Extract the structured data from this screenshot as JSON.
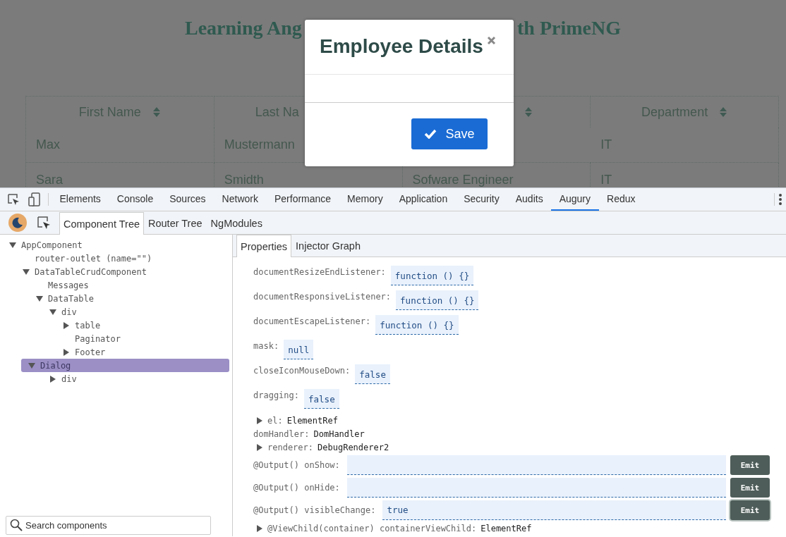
{
  "app": {
    "title_parts": [
      "Learning Ang",
      "th PrimeNG"
    ],
    "table": {
      "columns": [
        {
          "label": "First Name",
          "sortable": true
        },
        {
          "label": "Last Na"
        },
        {
          "sortable": true
        },
        {
          "label": "Department",
          "sortable": true
        }
      ],
      "rows": [
        [
          "Max",
          "Mustermann",
          null,
          "IT"
        ],
        [
          "Sara",
          "Smidth",
          "Sofware Engineer",
          "IT"
        ]
      ]
    }
  },
  "dialog": {
    "title": "Employee Details",
    "save_button": "Save"
  },
  "devtools": {
    "tabs": [
      {
        "label": "Elements",
        "selected": false
      },
      {
        "label": "Console",
        "selected": false
      },
      {
        "label": "Sources",
        "selected": false
      },
      {
        "label": "Network",
        "selected": false
      },
      {
        "label": "Performance",
        "selected": false
      },
      {
        "label": "Memory",
        "selected": false
      },
      {
        "label": "Application",
        "selected": false
      },
      {
        "label": "Security",
        "selected": false
      },
      {
        "label": "Audits",
        "selected": false
      },
      {
        "label": "Augury",
        "selected": true
      },
      {
        "label": "Redux",
        "selected": false
      }
    ],
    "augury_tabs": [
      {
        "label": "Component Tree",
        "selected": true
      },
      {
        "label": "Router Tree",
        "selected": false
      },
      {
        "label": "NgModules",
        "selected": false
      }
    ],
    "tree": [
      {
        "label": "AppComponent",
        "kind": "branch",
        "expanded": true,
        "selected": false,
        "children": [
          {
            "label": "router-outlet (name=\"\")",
            "kind": "leaf",
            "selected": false
          },
          {
            "label": "DataTableCrudComponent",
            "kind": "branch",
            "expanded": true,
            "selected": false,
            "children": [
              {
                "label": "Messages",
                "kind": "leaf",
                "selected": false
              },
              {
                "label": "DataTable",
                "kind": "branch",
                "expanded": true,
                "selected": false,
                "children": [
                  {
                    "label": "div",
                    "kind": "branch",
                    "expanded": true,
                    "selected": false,
                    "children": [
                      {
                        "label": "table",
                        "kind": "branch",
                        "expanded": false,
                        "selected": false
                      },
                      {
                        "label": "Paginator",
                        "kind": "leaf",
                        "selected": false
                      },
                      {
                        "label": "Footer",
                        "kind": "branch",
                        "expanded": false,
                        "selected": false
                      }
                    ]
                  }
                ]
              },
              {
                "label": "Dialog",
                "kind": "branch",
                "expanded": true,
                "selected": true,
                "children": [
                  {
                    "label": "div",
                    "kind": "branch",
                    "expanded": false,
                    "selected": false
                  }
                ]
              }
            ]
          }
        ]
      }
    ],
    "search": {
      "placeholder": "Search components"
    },
    "detail_tabs": [
      {
        "label": "Properties",
        "selected": true
      },
      {
        "label": "Injector Graph",
        "selected": false
      }
    ],
    "properties": [
      {
        "kind": "value",
        "key": "documentResizeEndListener:",
        "value": "function () {}"
      },
      {
        "kind": "value",
        "key": "documentResponsiveListener:",
        "value": "function () {}"
      },
      {
        "kind": "value",
        "key": "documentEscapeListener:",
        "value": "function () {}"
      },
      {
        "kind": "value",
        "key": "mask:",
        "value": "null"
      },
      {
        "kind": "value",
        "key": "closeIconMouseDown:",
        "value": "false"
      },
      {
        "kind": "value",
        "key": "dragging:",
        "value": "false"
      },
      {
        "kind": "object",
        "key": "el:",
        "type": "ElementRef",
        "expandable": true
      },
      {
        "kind": "object",
        "key": "domHandler:",
        "type": "DomHandler",
        "expandable": false
      },
      {
        "kind": "object",
        "key": "renderer:",
        "type": "DebugRenderer2",
        "expandable": true
      },
      {
        "kind": "output",
        "key": "@Output() onShow:",
        "emit": "Emit",
        "focused": false
      },
      {
        "kind": "output",
        "key": "@Output() onHide:",
        "emit": "Emit",
        "focused": false
      },
      {
        "kind": "output",
        "key": "@Output() visibleChange:",
        "value": "true",
        "emit": "Emit",
        "focused": true
      },
      {
        "kind": "object",
        "key": "@ViewChild(container) containerViewChild:",
        "type": "ElementRef",
        "expandable": true
      }
    ]
  }
}
